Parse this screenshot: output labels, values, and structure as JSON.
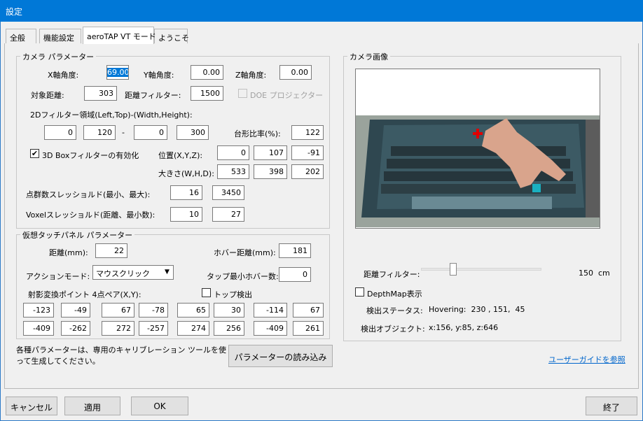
{
  "window": {
    "title": "設定"
  },
  "tabs": [
    "全般",
    "機能設定",
    "aeroTAP VT モード",
    "ようこそ"
  ],
  "camera_params": {
    "group_title": "カメラ パラメーター",
    "x_angle_label": "X軸角度:",
    "x_angle": "69.00",
    "y_angle_label": "Y軸角度:",
    "y_angle": "0.00",
    "z_angle_label": "Z軸角度:",
    "z_angle": "0.00",
    "target_distance_label": "対象距離:",
    "target_distance": "303",
    "distance_filter_label": "距離フィルター:",
    "distance_filter": "1500",
    "doe_label": "DOE プロジェクター",
    "filter2d_label": "2Dフィルター領域(Left,Top)-(Width,Height):",
    "filter2d_left": "0",
    "filter2d_top": "120",
    "filter2d_dash": "-",
    "filter2d_width": "0",
    "filter2d_height": "300",
    "trapezoid_label": "台形比率(%):",
    "trapezoid": "122",
    "box3d_label": "3D Boxフィルターの有効化",
    "box3d_checked": "✔",
    "position_label": "位置(X,Y,Z):",
    "pos_x": "0",
    "pos_y": "107",
    "pos_z": "-91",
    "size_label": "大きさ(W,H,D):",
    "size_w": "533",
    "size_h": "398",
    "size_d": "202",
    "point_threshold_label": "点群数スレッショルド(最小、最大):",
    "point_min": "16",
    "point_max": "3450",
    "voxel_threshold_label": "Voxelスレッショルド(距離、最小数):",
    "voxel_distance": "10",
    "voxel_min": "27"
  },
  "touch_panel": {
    "group_title": "仮想タッチパネル パラメーター",
    "distance_label": "距離(mm):",
    "distance": "22",
    "hover_distance_label": "ホバー距離(mm):",
    "hover_distance": "181",
    "action_mode_label": "アクションモード:",
    "action_mode": "マウスクリック",
    "tap_min_hover_label": "タップ最小ホバー数:",
    "tap_min_hover": "0",
    "projection_label": "射影変換ポイント 4点ペア(X,Y):",
    "top_detect_label": "トップ検出",
    "points_row1": [
      "-123",
      "-49",
      "67",
      "-78",
      "65",
      "30",
      "-114",
      "67"
    ],
    "points_row2": [
      "-409",
      "-262",
      "272",
      "-257",
      "274",
      "256",
      "-409",
      "261"
    ]
  },
  "calibration_note": "各種パラメーターは、専用のキャリブレーション ツールを使って生成してください。",
  "load_params_button": "パラメーターの読み込み",
  "camera_image": {
    "group_title": "カメラ画像",
    "distance_filter_label": "距離フィルター:",
    "distance_filter_value": "150",
    "distance_filter_unit": "cm",
    "distance_filter_level": 0.27,
    "depthmap_label": "DepthMap表示",
    "status_label": "検出ステータス:",
    "status_value": "Hovering:  230 , 151,  45",
    "object_label": "検出オブジェクト:",
    "object_value": "x:156, y:85, z:646"
  },
  "user_guide_link": "ユーザーガイドを参照",
  "footer": {
    "cancel": "キャンセル",
    "apply": "適用",
    "ok": "OK",
    "exit": "終了"
  },
  "colors": {
    "titlebar": "#0078d7",
    "link": "#0066cc",
    "marker_cross": "#e00000",
    "marker_square": "#1ab0c0"
  }
}
